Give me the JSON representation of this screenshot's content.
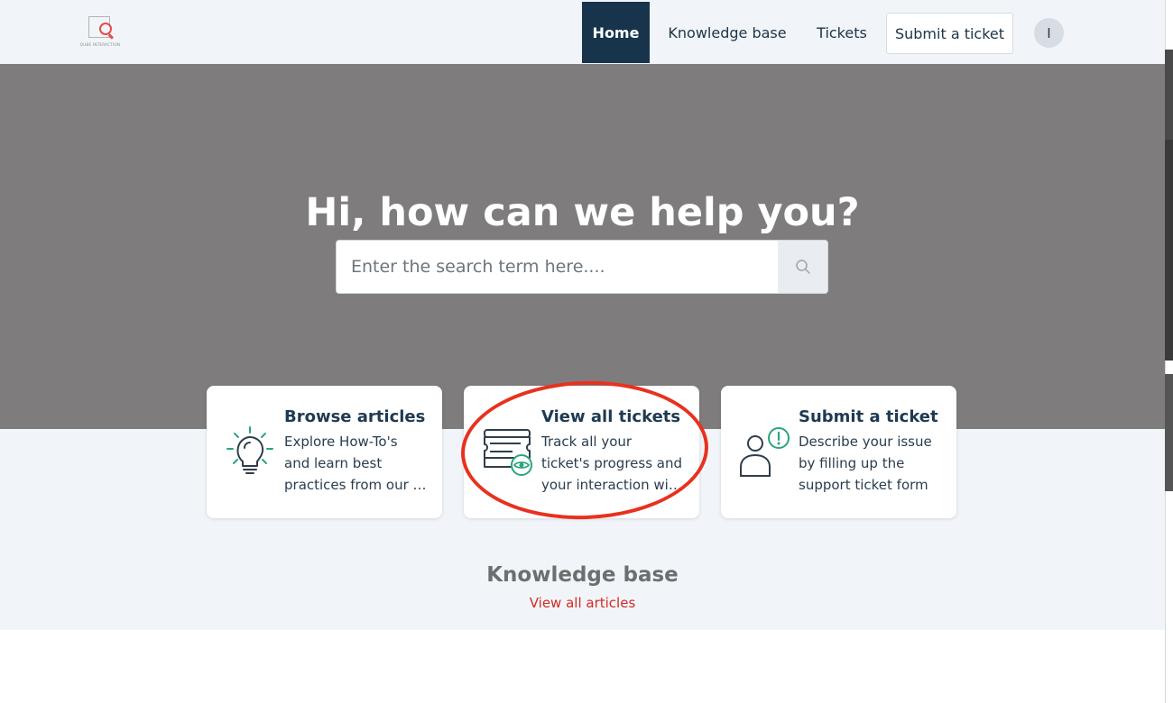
{
  "header": {
    "logo_text": "QUBE INTERACTION",
    "nav": {
      "home": "Home",
      "knowledge_base": "Knowledge base",
      "tickets": "Tickets",
      "submit_ticket": "Submit a ticket"
    },
    "avatar_initial": "I"
  },
  "hero": {
    "title": "Hi, how can we help you?",
    "search_placeholder": "Enter the search term here...."
  },
  "cards": [
    {
      "title": "Browse articles",
      "desc_lines": [
        "Explore How-To's",
        "and learn best",
        "practices from our experts"
      ],
      "icon": "lightbulb-icon"
    },
    {
      "title": "View all tickets",
      "desc_lines": [
        "Track all your",
        "ticket's progress and",
        "your interaction with us"
      ],
      "icon": "ticket-eye-icon"
    },
    {
      "title": "Submit a ticket",
      "desc_lines": [
        "Describe your issue",
        "by filling up the",
        "support ticket form"
      ],
      "icon": "user-alert-icon"
    }
  ],
  "knowledge_base": {
    "title": "Knowledge base",
    "link": "View all articles"
  },
  "colors": {
    "nav_active": "#17344c",
    "hero_bg": "#7f7c7d",
    "accent_green": "#2aa57d",
    "link_red": "#d42a22",
    "annotation": "#e8311e"
  }
}
